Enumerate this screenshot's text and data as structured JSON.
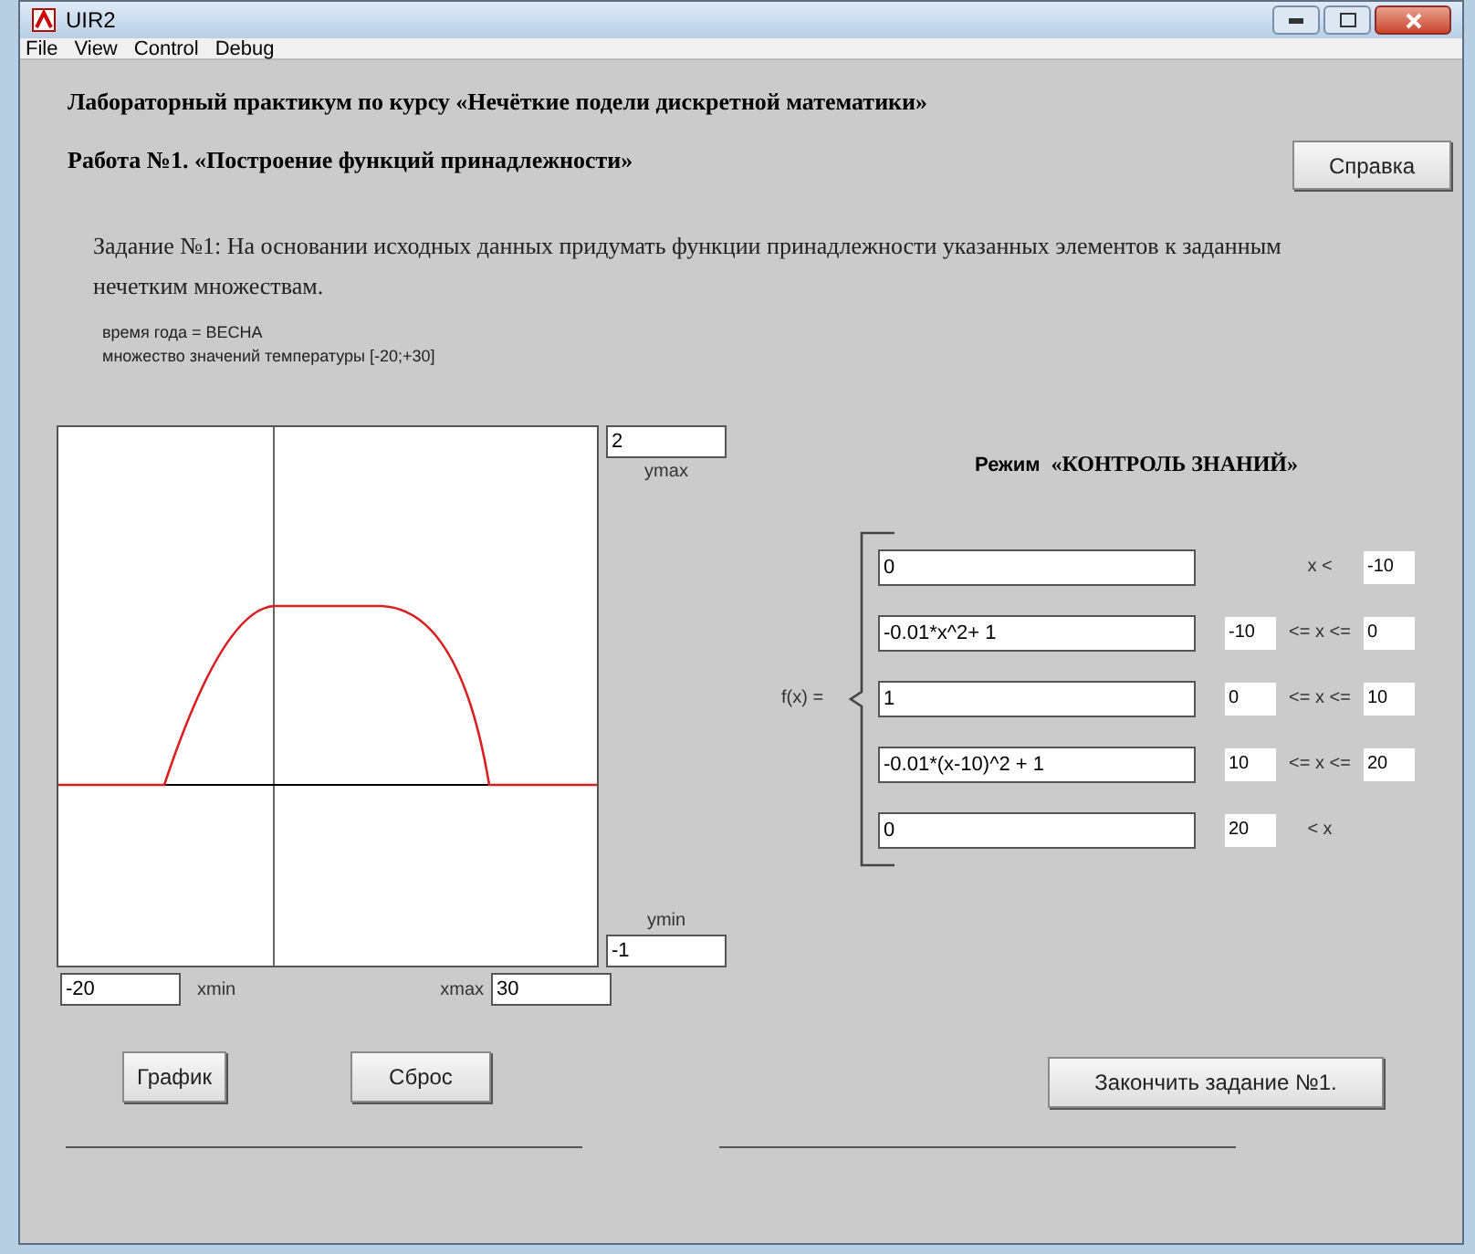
{
  "window": {
    "title": "UIR2"
  },
  "menu": [
    "File",
    "View",
    "Control",
    "Debug"
  ],
  "headings": [
    "Лабораторный практикум по курсу «Нечёткие подели дискретной математики»",
    "Работа №1. «Построение функций принадлежности»"
  ],
  "help_button": "Справка",
  "task": "Задание №1: На основании исходных данных придумать функции принадлежности указанных элементов к заданным нечетким множествам.",
  "conditions": [
    "время года = ВЕСНА",
    "множество значений температуры [-20;+30]"
  ],
  "plot": {
    "ymax": {
      "label": "ymax",
      "value": "2"
    },
    "ymin": {
      "label": "ymin",
      "value": "-1"
    },
    "xmin": {
      "label": "xmin",
      "value": "-20"
    },
    "xmax": {
      "label": "xmax",
      "value": "30"
    }
  },
  "mode": {
    "prefix": "Режим",
    "name": "«КОНТРОЛЬ ЗНАНИЙ»"
  },
  "piecewise": {
    "label": "f(x) =",
    "rows": [
      {
        "formula": "0",
        "relation": "x <",
        "to": "-10"
      },
      {
        "formula": "-0.01*x^2+ 1",
        "from": "-10",
        "relation": "<= x <=",
        "to": "0"
      },
      {
        "formula": "1",
        "from": "0",
        "relation": "<= x <=",
        "to": "10"
      },
      {
        "formula": "-0.01*(x-10)^2 + 1",
        "from": "10",
        "relation": "<= x <=",
        "to": "20"
      },
      {
        "formula": "0",
        "from": "20",
        "relation": "< x"
      }
    ]
  },
  "buttons": {
    "plot": "График",
    "reset": "Сброс",
    "finish": "Закончить задание №1."
  }
}
